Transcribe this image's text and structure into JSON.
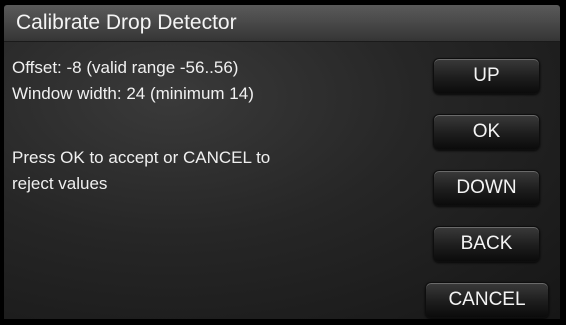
{
  "title": "Calibrate Drop Detector",
  "message": {
    "offset_line": "Offset: -8 (valid range -56..56)",
    "window_width_line": "Window width: 24 (minimum 14)",
    "prompt_line_1": "Press OK to accept or CANCEL to",
    "prompt_line_2": "reject values"
  },
  "buttons": {
    "up": "UP",
    "ok": "OK",
    "down": "DOWN",
    "back": "BACK",
    "cancel": "CANCEL"
  }
}
